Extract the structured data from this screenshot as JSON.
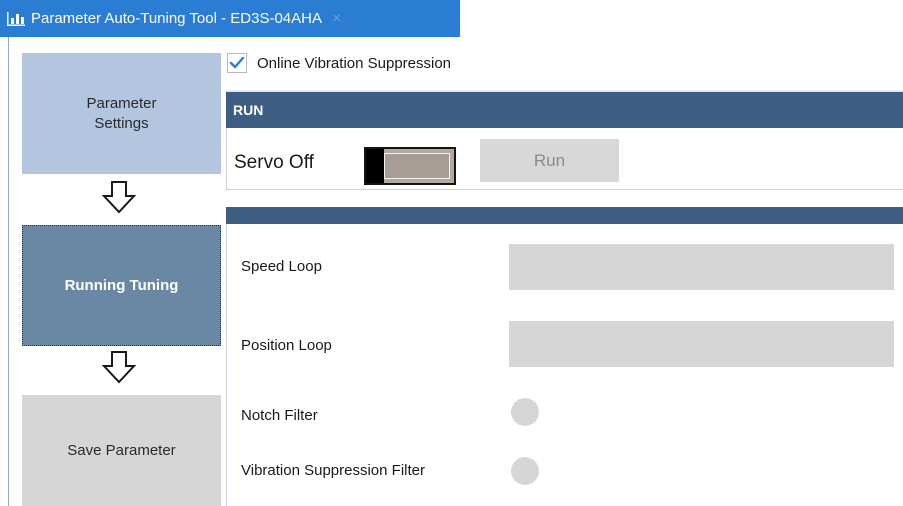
{
  "tab": {
    "title": "Parameter Auto-Tuning Tool - ED3S-04AHA",
    "close_label": "×",
    "icon": "bar-chart-icon"
  },
  "steps": {
    "parameter_settings": "Parameter Settings",
    "running_tuning": "Running Tuning",
    "save_parameter": "Save Parameter"
  },
  "online_vibration": {
    "label": "Online Vibration Suppression",
    "checked": true
  },
  "run_section": {
    "header": "RUN",
    "servo_label": "Servo Off",
    "servo_on": false,
    "run_button": "Run"
  },
  "tuning": {
    "speed_loop": "Speed Loop",
    "position_loop": "Position Loop",
    "notch_filter": "Notch Filter",
    "vibration_filter": "Vibration Suppression Filter"
  },
  "colors": {
    "tab_blue": "#2b7cd3",
    "header_blue": "#3d5e82",
    "step_active": "#6a88a4",
    "step_done": "#b3c5df",
    "step_pending": "#d6d6d6"
  }
}
